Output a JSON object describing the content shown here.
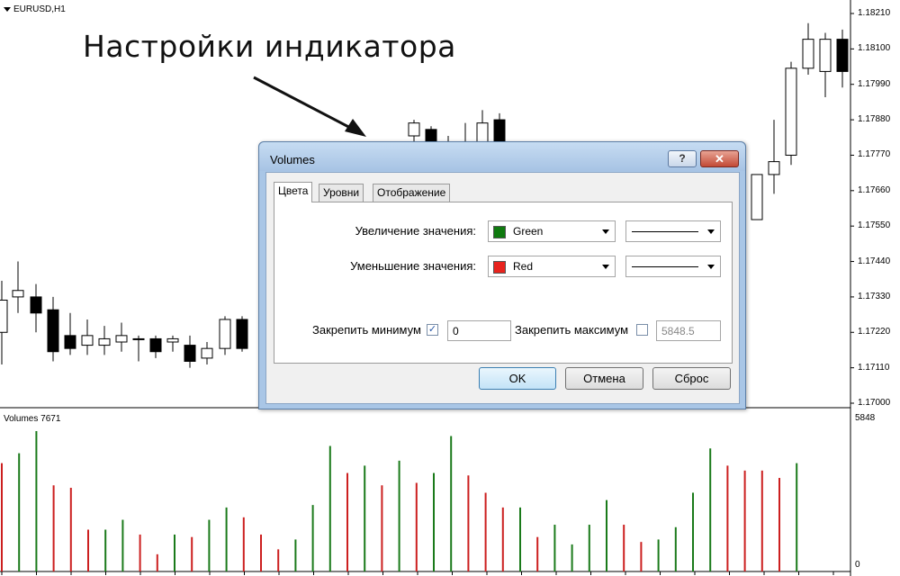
{
  "chart": {
    "symbol": "EURUSD,H1",
    "price_ticks": [
      "1.18210",
      "1.18100",
      "1.17990",
      "1.17880",
      "1.17770",
      "1.17660",
      "1.17550",
      "1.17440",
      "1.17330",
      "1.17220",
      "1.17110",
      "1.17000"
    ],
    "price_range": [
      1.17,
      1.1821
    ],
    "candles": [
      {
        "o": 1.1722,
        "h": 1.1738,
        "l": 1.1712,
        "c": 1.1732
      },
      {
        "o": 1.1733,
        "h": 1.1744,
        "l": 1.1728,
        "c": 1.1735
      },
      {
        "o": 1.1733,
        "h": 1.1737,
        "l": 1.1722,
        "c": 1.1728
      },
      {
        "o": 1.1729,
        "h": 1.1733,
        "l": 1.1713,
        "c": 1.1716
      },
      {
        "o": 1.1721,
        "h": 1.1728,
        "l": 1.1715,
        "c": 1.1717
      },
      {
        "o": 1.1718,
        "h": 1.1726,
        "l": 1.1715,
        "c": 1.1721
      },
      {
        "o": 1.1718,
        "h": 1.1724,
        "l": 1.1715,
        "c": 1.172
      },
      {
        "o": 1.1719,
        "h": 1.1725,
        "l": 1.1716,
        "c": 1.1721
      },
      {
        "o": 1.172,
        "h": 1.1721,
        "l": 1.1713,
        "c": 1.172
      },
      {
        "o": 1.172,
        "h": 1.1721,
        "l": 1.1714,
        "c": 1.1716
      },
      {
        "o": 1.1719,
        "h": 1.1721,
        "l": 1.1716,
        "c": 1.172
      },
      {
        "o": 1.1718,
        "h": 1.1721,
        "l": 1.1711,
        "c": 1.1713
      },
      {
        "o": 1.1714,
        "h": 1.1719,
        "l": 1.1712,
        "c": 1.1717
      },
      {
        "o": 1.1717,
        "h": 1.1727,
        "l": 1.1715,
        "c": 1.1726
      },
      {
        "o": 1.1726,
        "h": 1.1727,
        "l": 1.1716,
        "c": 1.1717
      },
      {
        "o": 1.1783,
        "h": 1.1788,
        "l": 1.1774,
        "c": 1.1787
      },
      {
        "o": 1.1785,
        "h": 1.1786,
        "l": 1.1776,
        "c": 1.1779
      },
      {
        "o": 1.178,
        "h": 1.1783,
        "l": 1.1776,
        "c": 1.1781
      },
      {
        "o": 1.178,
        "h": 1.1787,
        "l": 1.1774,
        "c": 1.178
      },
      {
        "o": 1.1781,
        "h": 1.1791,
        "l": 1.1774,
        "c": 1.1787
      },
      {
        "o": 1.1788,
        "h": 1.179,
        "l": 1.1774,
        "c": 1.178
      },
      {
        "o": 1.1757,
        "h": 1.1768,
        "l": 1.1757,
        "c": 1.1771
      },
      {
        "o": 1.1771,
        "h": 1.1788,
        "l": 1.1765,
        "c": 1.1775
      },
      {
        "o": 1.1777,
        "h": 1.1806,
        "l": 1.1774,
        "c": 1.1804
      },
      {
        "o": 1.1804,
        "h": 1.1818,
        "l": 1.1802,
        "c": 1.1813
      },
      {
        "o": 1.1803,
        "h": 1.1815,
        "l": 1.1795,
        "c": 1.1813
      },
      {
        "o": 1.1813,
        "h": 1.1816,
        "l": 1.1798,
        "c": 1.1803
      },
      {
        "o": 1.1804,
        "h": 1.1814,
        "l": 1.1803,
        "c": 1.1808
      }
    ],
    "volume_label": "Volumes 7671",
    "volume_max_label": "5848",
    "volume_zero_label": "0",
    "volume_max": 5848,
    "volumes": [
      {
        "v": 4400,
        "up": false
      },
      {
        "v": 4800,
        "up": true
      },
      {
        "v": 5700,
        "up": true
      },
      {
        "v": 3500,
        "up": false
      },
      {
        "v": 3400,
        "up": false
      },
      {
        "v": 1700,
        "up": false
      },
      {
        "v": 1700,
        "up": true
      },
      {
        "v": 2100,
        "up": true
      },
      {
        "v": 1500,
        "up": false
      },
      {
        "v": 700,
        "up": false
      },
      {
        "v": 1500,
        "up": true
      },
      {
        "v": 1400,
        "up": false
      },
      {
        "v": 2100,
        "up": true
      },
      {
        "v": 2600,
        "up": true
      },
      {
        "v": 2200,
        "up": false
      },
      {
        "v": 1500,
        "up": false
      },
      {
        "v": 900,
        "up": false
      },
      {
        "v": 1300,
        "up": true
      },
      {
        "v": 2700,
        "up": true
      },
      {
        "v": 5100,
        "up": true
      },
      {
        "v": 4000,
        "up": false
      },
      {
        "v": 4300,
        "up": true
      },
      {
        "v": 3500,
        "up": false
      },
      {
        "v": 4500,
        "up": true
      },
      {
        "v": 3600,
        "up": false
      },
      {
        "v": 4000,
        "up": true
      },
      {
        "v": 5500,
        "up": true
      },
      {
        "v": 3900,
        "up": false
      },
      {
        "v": 3200,
        "up": false
      },
      {
        "v": 2600,
        "up": false
      },
      {
        "v": 2600,
        "up": true
      },
      {
        "v": 1400,
        "up": false
      },
      {
        "v": 1900,
        "up": true
      },
      {
        "v": 1100,
        "up": true
      },
      {
        "v": 1900,
        "up": true
      },
      {
        "v": 2900,
        "up": true
      },
      {
        "v": 1900,
        "up": false
      },
      {
        "v": 1200,
        "up": false
      },
      {
        "v": 1300,
        "up": true
      },
      {
        "v": 1800,
        "up": true
      },
      {
        "v": 3200,
        "up": true
      },
      {
        "v": 5000,
        "up": true
      },
      {
        "v": 4300,
        "up": false
      },
      {
        "v": 4100,
        "up": false
      },
      {
        "v": 4100,
        "up": false
      },
      {
        "v": 3800,
        "up": false
      },
      {
        "v": 4400,
        "up": true
      }
    ],
    "colors": {
      "up_volume": "#1a7a1a",
      "down_volume": "#cc1f1f",
      "candle": "#000000"
    }
  },
  "annotation": "Настройки индикатора",
  "dialog": {
    "title": "Volumes",
    "help_label": "?",
    "close_label": "✕",
    "tabs": [
      {
        "label": "Цвета",
        "active": true
      },
      {
        "label": "Уровни",
        "active": false
      },
      {
        "label": "Отображение",
        "active": false
      }
    ],
    "increase_label": "Увеличение значения:",
    "increase_color": {
      "name": "Green",
      "hex": "#0f7a0f"
    },
    "decrease_label": "Уменьшение значения:",
    "decrease_color": {
      "name": "Red",
      "hex": "#e8231e"
    },
    "fix_min_label": "Закрепить минимум",
    "fix_min_checked": true,
    "fix_min_value": "0",
    "fix_max_label": "Закрепить максимум",
    "fix_max_checked": false,
    "fix_max_value": "5848.5",
    "ok_label": "OK",
    "cancel_label": "Отмена",
    "reset_label": "Сброс"
  }
}
